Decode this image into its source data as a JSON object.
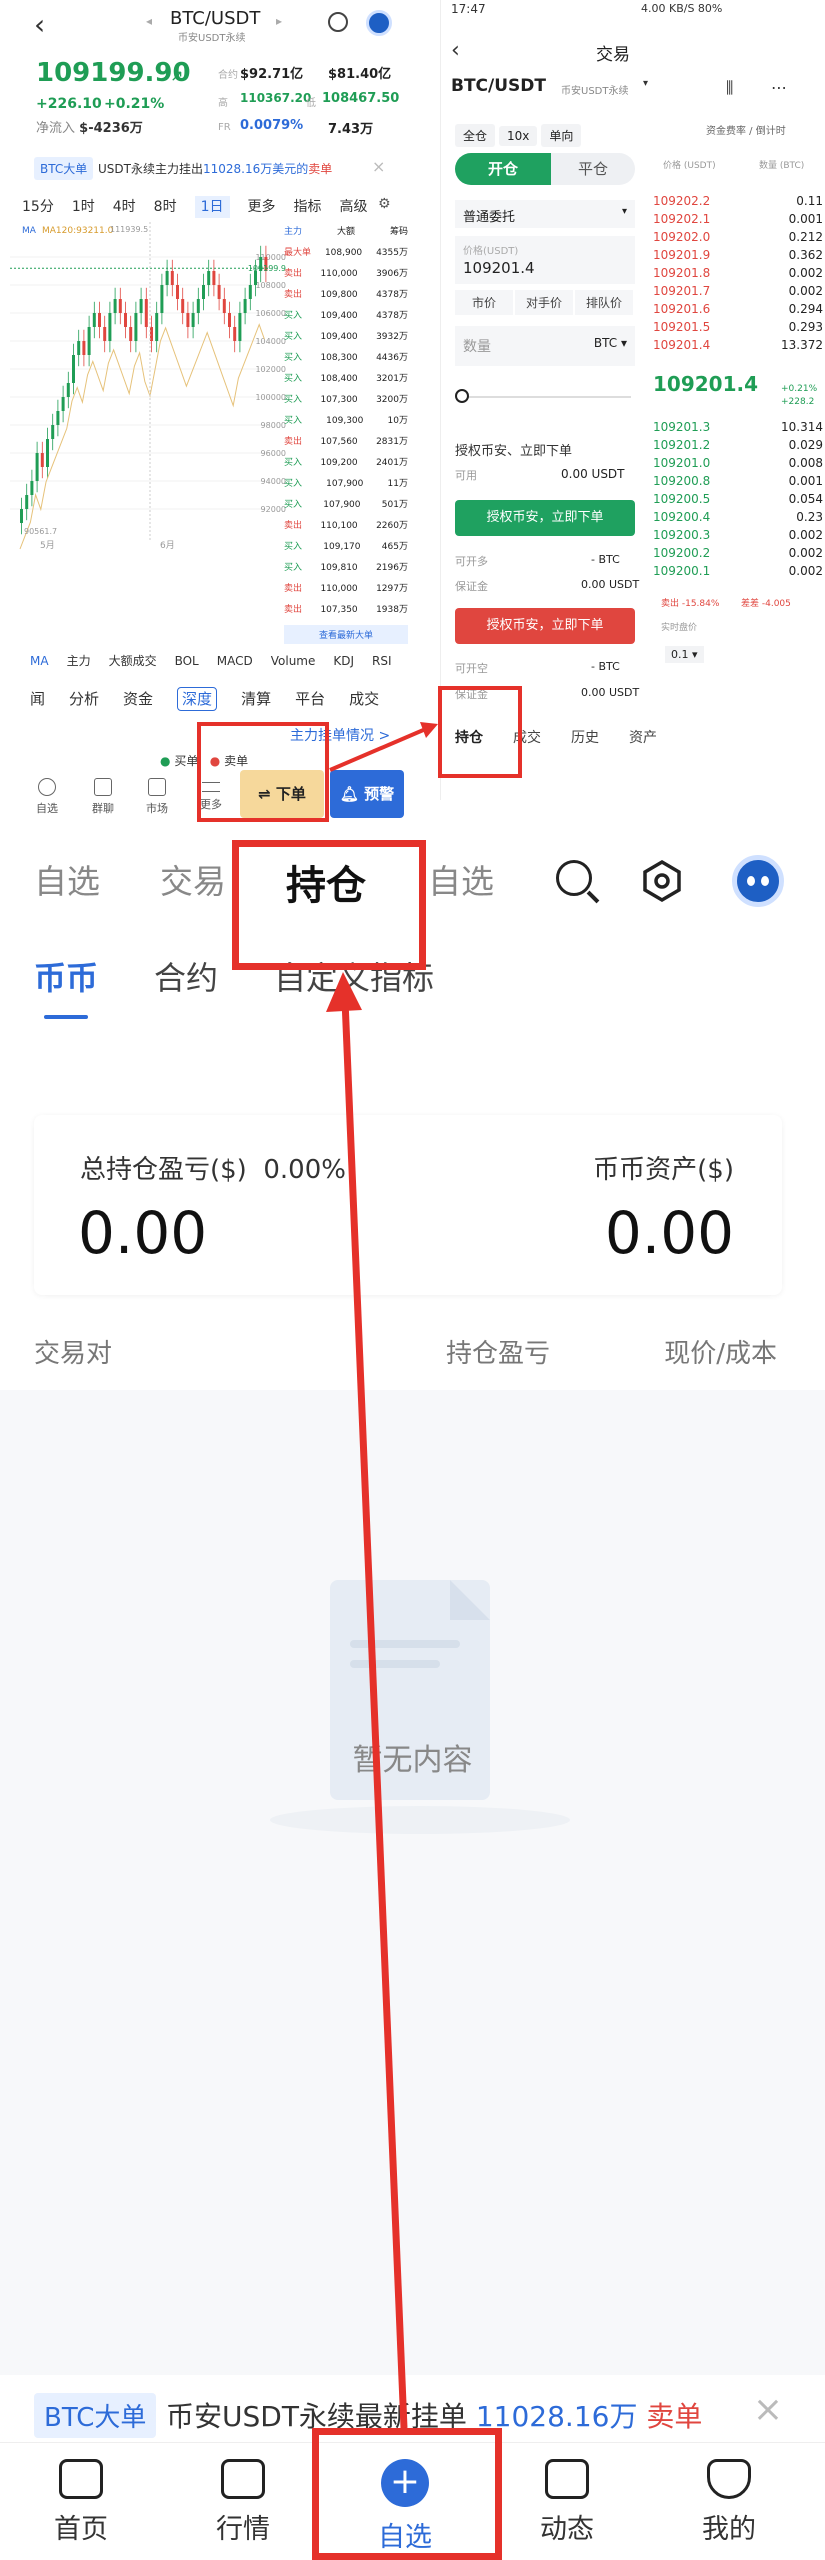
{
  "left": {
    "pair": "BTC/USDT",
    "pair_sub": "币安USDT永续",
    "price": "109199.90",
    "price_arrow": "↗",
    "change": "+226.10",
    "change_pct": "+0.21%",
    "net_inflow_label": "净流入",
    "net_inflow": "$-4236万",
    "stats": [
      {
        "label": "合约",
        "value": "$92.71亿"
      },
      {
        "label": "",
        "value": "$81.40亿"
      },
      {
        "label": "高",
        "value": "110367.20"
      },
      {
        "label": "低",
        "value": "108467.50"
      },
      {
        "label": "FR",
        "value": "0.0079%"
      },
      {
        "label": "",
        "value": "7.43万"
      }
    ],
    "notice_tag": "BTC大单",
    "notice_text": "USDT永续主力挂出",
    "notice_amount": "11028.16万美元的",
    "notice_side": "卖单",
    "periods": [
      "15分",
      "1时",
      "4时",
      "8时",
      "1日",
      "更多",
      "指标",
      "高级"
    ],
    "active_period": "1日",
    "ma_label": "MA",
    "ma_value": "MA120:93211.0",
    "chart_high_label": "111939.5",
    "chart_low_label": "90561.7",
    "chart_price_tag": "109199.9",
    "month_labels": [
      "5月",
      "6月"
    ],
    "chart_ticks": [
      "110000",
      "108000",
      "106000",
      "104000",
      "102000",
      "100000",
      "98000",
      "96000",
      "94000",
      "92000"
    ],
    "book_header": [
      "主力",
      "大额",
      "筹码"
    ],
    "book_rows": [
      {
        "side": "最大单",
        "price": "108,900",
        "qty": "4355万"
      },
      {
        "side": "卖出",
        "price": "110,000",
        "qty": "3906万"
      },
      {
        "side": "卖出",
        "price": "109,800",
        "qty": "4378万"
      },
      {
        "side": "买入",
        "price": "109,400",
        "qty": "4378万"
      },
      {
        "side": "买入",
        "price": "109,400",
        "qty": "3932万"
      },
      {
        "side": "买入",
        "price": "108,300",
        "qty": "4436万"
      },
      {
        "side": "买入",
        "price": "108,400",
        "qty": "3201万"
      },
      {
        "side": "买入",
        "price": "107,300",
        "qty": "3200万"
      },
      {
        "side": "买入",
        "price": "109,300",
        "qty": "10万"
      },
      {
        "side": "卖出",
        "price": "107,560",
        "qty": "2831万"
      },
      {
        "side": "买入",
        "price": "109,200",
        "qty": "2401万"
      },
      {
        "side": "买入",
        "price": "107,900",
        "qty": "11万"
      },
      {
        "side": "买入",
        "price": "107,900",
        "qty": "501万"
      },
      {
        "side": "卖出",
        "price": "110,100",
        "qty": "2260万"
      },
      {
        "side": "买入",
        "price": "109,170",
        "qty": "465万"
      },
      {
        "side": "买入",
        "price": "109,810",
        "qty": "2196万"
      },
      {
        "side": "卖出",
        "price": "110,000",
        "qty": "1297万"
      },
      {
        "side": "卖出",
        "price": "107,350",
        "qty": "1938万"
      }
    ],
    "book_more": "查看最新大单",
    "indicators": [
      "MA",
      "主力",
      "大额成交",
      "BOL",
      "MACD",
      "Volume",
      "KDJ",
      "RSI"
    ],
    "tabs": [
      "闻",
      "分析",
      "资金",
      "深度",
      "清算",
      "平台",
      "成交"
    ],
    "active_tab": "深度",
    "main_hint": "主力挂单情况 >",
    "legend_buy": "买单",
    "legend_sell": "卖单",
    "bottom_icons": [
      "自选",
      "群聊",
      "市场",
      "更多"
    ],
    "order_btn": "⇌ 下单",
    "alert_btn": "预警"
  },
  "right": {
    "status_time": "17:47",
    "status_right": "4.00 KB/S  80%",
    "title": "交易",
    "pair": "BTC/USDT",
    "pair_sub": "币安USDT永续",
    "modes": [
      "全仓",
      "10x",
      "单向"
    ],
    "fee_info": "资金费率 / 倒计时",
    "open_btn": "开仓",
    "close_btn": "平仓",
    "order_type": "普通委托",
    "price_label": "价格(USDT)",
    "price_value": "109201.4",
    "quick_btns": [
      "市价",
      "对手价",
      "排队价"
    ],
    "qty_placeholder": "数量",
    "qty_unit": "BTC",
    "grant_text": "授权币安、立即下单",
    "available_label": "可用",
    "available_value": "0.00 USDT",
    "grant_btn_buy": "授权币安，立即下单",
    "grant_btn_sell": "授权币安，立即下单",
    "can_open_long": "可开多",
    "can_open_long_v": "- BTC",
    "margin_label": "保证金",
    "margin_v": "0.00 USDT",
    "can_open_short": "可开空",
    "can_open_short_v": "- BTC",
    "margin_label2": "保证金",
    "margin_v2": "0.00 USDT",
    "book_head": [
      "价格 (USDT)",
      "数量 (BTC)"
    ],
    "asks": [
      {
        "p": "109202.2",
        "q": "0.11"
      },
      {
        "p": "109202.1",
        "q": "0.001"
      },
      {
        "p": "109202.0",
        "q": "0.212"
      },
      {
        "p": "109201.9",
        "q": "0.362"
      },
      {
        "p": "109201.8",
        "q": "0.002"
      },
      {
        "p": "109201.7",
        "q": "0.002"
      },
      {
        "p": "109201.6",
        "q": "0.294"
      },
      {
        "p": "109201.5",
        "q": "0.293"
      },
      {
        "p": "109201.4",
        "q": "13.372"
      }
    ],
    "mid_price": "109201.4",
    "mid_pct": "+0.21%",
    "mid_chg": "+228.2",
    "bids": [
      {
        "p": "109201.3",
        "q": "10.314"
      },
      {
        "p": "109201.2",
        "q": "0.029"
      },
      {
        "p": "109201.0",
        "q": "0.008"
      },
      {
        "p": "109200.8",
        "q": "0.001"
      },
      {
        "p": "109200.5",
        "q": "0.054"
      },
      {
        "p": "109200.4",
        "q": "0.23"
      },
      {
        "p": "109200.3",
        "q": "0.002"
      },
      {
        "p": "109200.2",
        "q": "0.002"
      },
      {
        "p": "109200.1",
        "q": "0.002"
      }
    ],
    "ratio_buy": "卖出 -15.84%",
    "ratio_sell": "差差 -4.005",
    "ref_label": "实时盘价",
    "step": "0.1",
    "tabs": [
      "持仓",
      "成交",
      "历史",
      "资产"
    ],
    "active_tab": "持仓"
  },
  "main": {
    "nav_tabs": [
      "自选",
      "交易",
      "持仓",
      "自选"
    ],
    "active_nav": "持仓",
    "sub_tabs": [
      "币币",
      "合约",
      "自定义指标"
    ],
    "active_sub": "币币",
    "pnl_label": "总持仓盈亏($)",
    "pnl_pct": "0.00%",
    "pnl_value": "0.00",
    "asset_label": "币币资产($)",
    "asset_value": "0.00",
    "col_pair": "交易对",
    "col_pnl": "持仓盈亏",
    "col_price": "现价/成本",
    "empty_text": "暂无内容",
    "notice_tag": "BTC大单",
    "notice_text": "币安USDT永续最新挂单",
    "notice_amount": "11028.16万",
    "notice_side": "卖单",
    "tabbar": [
      "首页",
      "行情",
      "自选",
      "动态",
      "我的"
    ],
    "active_tab": "自选"
  },
  "colors": {
    "green": "#1f9d55",
    "red": "#e0463f",
    "blue": "#2d6bd8",
    "annotation_red": "#e5312a"
  }
}
